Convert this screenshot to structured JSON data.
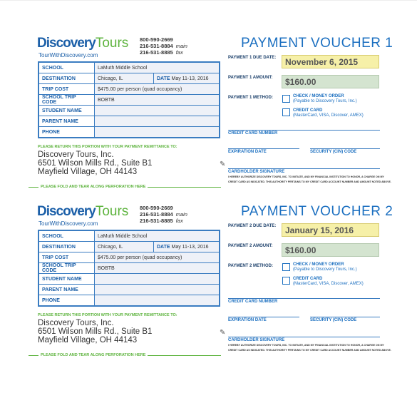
{
  "company": {
    "logo_a": "Discovery",
    "logo_b": "Tours",
    "url": "TourWithDiscovery.com",
    "phone_main_toll": "800-590-2669",
    "phone_main": "216-531-8884",
    "phone_main_label": "main",
    "phone_fax": "216-531-8885",
    "phone_fax_label": "fax"
  },
  "form": {
    "school_label": "SCHOOL",
    "school": "LaMuth Middle School",
    "destination_label": "DESTINATION",
    "destination": "Chicago, IL",
    "date_label": "DATE",
    "date": "May 11-13, 2016",
    "trip_cost_label": "TRIP COST",
    "trip_cost": "$475.00 per person (quad occupancy)",
    "code_label": "SCHOOL TRIP CODE",
    "code": "BOBTB",
    "student_label": "STUDENT NAME",
    "parent_label": "PARENT NAME",
    "phone_label": "PHONE"
  },
  "return_note": "PLEASE RETURN THIS PORTION WITH YOUR PAYMENT REMITTANCE TO:",
  "address": [
    "Discovery Tours, Inc.",
    "6501 Wilson Mills Rd., Suite B1",
    "Mayfield Village, OH 44143"
  ],
  "fold_note": "PLEASE FOLD AND TEAR ALONG PERFORATION HERE",
  "method": {
    "check": "CHECK / MONEY ORDER",
    "check_sub": "(Payable to Discovery Tours, Inc.)",
    "card": "CREDIT CARD",
    "card_sub": "(MasterCard, VISA, Discover, AMEX)"
  },
  "card_fields": {
    "number": "CREDIT CARD NUMBER",
    "expiration": "EXPIRATION DATE",
    "security": "SECURITY (CIN) CODE",
    "signature": "CARDHOLDER SIGNATURE",
    "fine_1": "I HEREBY AUTHORIZE DISCOVERY TOURS, INC. TO INITIATE, AND MY FINANCIAL INSTITUTION TO HONOR, A CHARGE ON MY",
    "fine_2": "CREDIT CARD AS INDICATED. THIS AUTHORITY PERTAINS TO MY CREDIT CARD ACCOUNT NUMBER AND AMOUNT NOTED ABOVE."
  },
  "vouchers": [
    {
      "title": "PAYMENT VOUCHER  1",
      "due_label": "PAYMENT 1 DUE DATE:",
      "due": "November 6, 2015",
      "amount_label": "PAYMENT 1 AMOUNT:",
      "amount": "$160.00",
      "method_label": "PAYMENT 1 METHOD:"
    },
    {
      "title": "PAYMENT VOUCHER 2",
      "due_label": "PAYMENT 2 DUE DATE:",
      "due": "January 15, 2016",
      "amount_label": "PAYMENT 2 AMOUNT:",
      "amount": "$160.00",
      "method_label": "PAYMENT 2 METHOD:"
    }
  ],
  "colors": {
    "blue": "#1b6fc0",
    "green": "#5db33d",
    "due_fill": "#f6f0a8",
    "amount_fill": "#d4e4d0"
  }
}
